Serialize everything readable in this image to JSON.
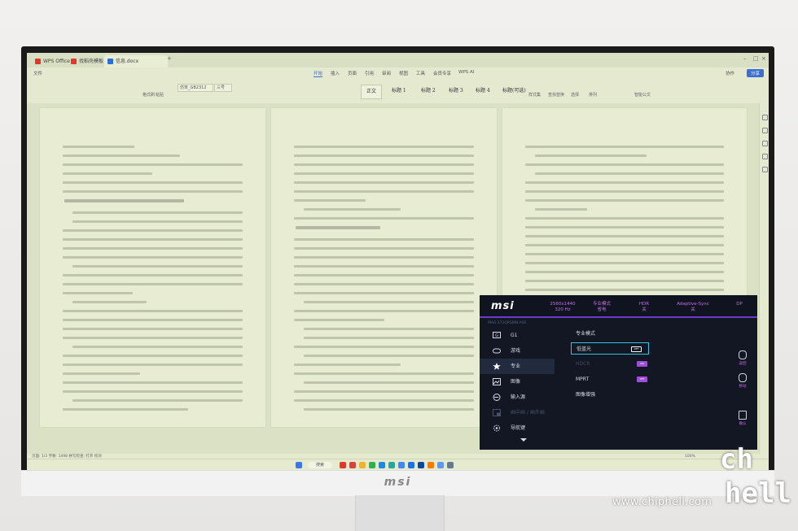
{
  "tabs": [
    {
      "label": "WPS Office",
      "icon": "wps-logo-icon",
      "color": "#e0392b"
    },
    {
      "label": "找稻壳模板",
      "icon": "docer-icon",
      "color": "#e0392b"
    },
    {
      "label": "信息.docx",
      "icon": "word-doc-icon",
      "color": "#2b6fd6",
      "active": true
    }
  ],
  "menu": {
    "file": "文件",
    "items": [
      "开始",
      "插入",
      "页面",
      "引用",
      "审阅",
      "视图",
      "工具",
      "会员专享"
    ],
    "wps_ai": "WPS AI",
    "active": "开始",
    "collab": "协作",
    "share": "分享"
  },
  "ribbon": {
    "groups": [
      "格式刷",
      "粘贴",
      "样式集",
      "查找替换",
      "选择",
      "排列",
      "智能公文"
    ],
    "font": "仿宋_GB2312",
    "size": "三号",
    "styles": [
      "正文",
      "标题 1",
      "标题 2",
      "标题 3",
      "标题 4",
      "标题(可选)"
    ]
  },
  "status": {
    "left": "页面: 1/3  字数: 1498  拼写检查: 打开  校对",
    "zoom": "100%"
  },
  "taskbar": {
    "search": "搜索",
    "time": "",
    "icons": [
      "start-icon",
      "search-icon",
      "wps-icon",
      "edge-icon",
      "folder-icon",
      "wechat-icon",
      "qq-icon",
      "app-icon",
      "ps-icon",
      "store-icon",
      "chrome-icon",
      "settings-icon"
    ]
  },
  "osd": {
    "brand": "msi",
    "info": [
      {
        "line1": "2560x1440",
        "line2": "320 Hz"
      },
      {
        "line1": "专业模式",
        "line2": "省电"
      },
      {
        "line1": "HDR",
        "line2": "关"
      },
      {
        "line1": "Adaptive-Sync",
        "line2": "关"
      },
      {
        "line1": "DP",
        "line2": ""
      }
    ],
    "model": "MAG 272QRSMN-ASE",
    "menu": [
      {
        "label": "G1",
        "icon": "monitor-g-icon",
        "dim": false
      },
      {
        "label": "游戏",
        "icon": "gamepad-icon",
        "dim": false
      },
      {
        "label": "专业",
        "icon": "star-icon",
        "dim": false,
        "selected": true
      },
      {
        "label": "图像",
        "icon": "image-icon",
        "dim": false
      },
      {
        "label": "输入源",
        "icon": "input-source-icon",
        "dim": false
      },
      {
        "label": "画中画 / 画外画",
        "icon": "pip-icon",
        "dim": true
      },
      {
        "label": "导航键",
        "icon": "gear-icon",
        "dim": false
      }
    ],
    "options": [
      {
        "label": "专业模式",
        "toggle": "",
        "dim": false
      },
      {
        "label": "低蓝光",
        "toggle": "OFF",
        "dim": false,
        "selected": true
      },
      {
        "label": "HDCR",
        "toggle": "ON",
        "dim": true
      },
      {
        "label": "MPRT",
        "toggle": "OFF",
        "dim": false
      },
      {
        "label": "图像增强",
        "toggle": "",
        "dim": false
      }
    ],
    "keys": [
      {
        "label": "返回",
        "icon": "back-key-icon"
      },
      {
        "label": "移动",
        "icon": "move-key-icon"
      },
      {
        "label": "确认",
        "icon": "confirm-key-icon"
      }
    ]
  },
  "bezel": {
    "logo": "msi"
  },
  "watermark": {
    "site": "www.chiphell.com",
    "logo": "chip hell"
  },
  "colors": {
    "osd_accent": "#a04dd9",
    "osd_select": "#33c2e8",
    "wps_blue": "#3a6fd1"
  }
}
